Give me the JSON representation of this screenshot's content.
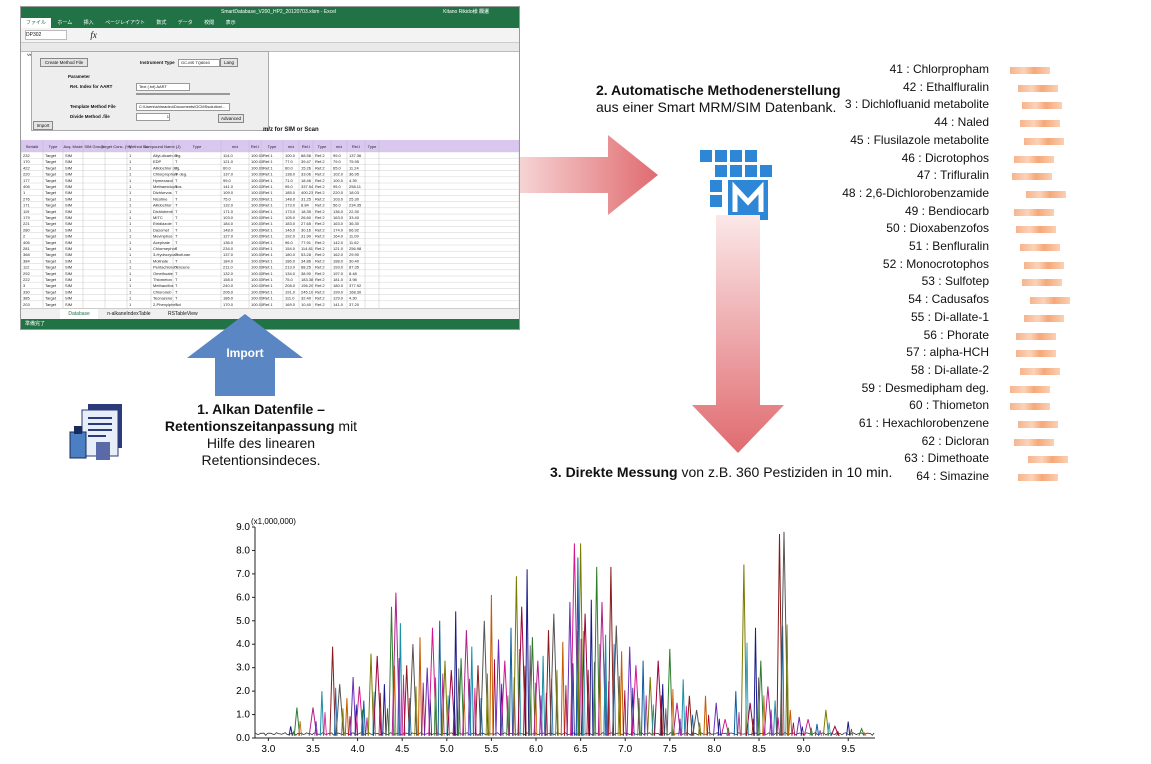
{
  "excel": {
    "title": "SmartDatabase_V200_HP2_20120703.xlsm - Excel",
    "user": "Kitano Rikido様 欄遷",
    "ribbon_tabs": [
      "ファイル",
      "ホーム",
      "挿入",
      "ページレイアウト",
      "数式",
      "データ",
      "校閲",
      "表示"
    ],
    "name_box": "DP302",
    "version_label": "Ver 0.99",
    "panel": {
      "create_button": "Create Method File",
      "instrument_label": "Instrument Type",
      "instrument_value": "GC-MS TQ8040",
      "lang_button": "Lang",
      "parameter_label": "Parameter",
      "ret_index_label": "Ret. Index for AART",
      "ret_index_value": "Text (.txt) AART",
      "template_label": "Template Method File",
      "template_value": "C:\\Users\\shimadzu\\Documents\\GCMSsolution\\...",
      "divide_label": "Divide Method .file",
      "divide_value": "1",
      "advanced_button": "Advanced",
      "import_button": "Import"
    },
    "header_label": "m/z for SIM or Scan",
    "columns": [
      "Serial#",
      "Type",
      "Acq. Mode",
      "SIM Group",
      "Target Conc. (%)",
      "Method No.",
      "Compound Name (J)",
      "Type",
      "m/z",
      "Rel.I",
      "Type",
      "m/z",
      "Rel.I",
      "Type",
      "m/z",
      "Rel.I",
      "Type"
    ],
    "rows": [
      [
        "232",
        "Target",
        "SIM",
        "",
        "",
        "1",
        "Allyl-dicarb deg.",
        "T",
        "114.0",
        "100.00",
        "Ref.1",
        "100.0",
        "88.56",
        "Ref.2",
        "99.0",
        "137.36"
      ],
      [
        "170",
        "Target",
        "SIM",
        "",
        "",
        "1",
        "EDP",
        "T",
        "121.0",
        "100.00",
        "Ref.1",
        "77.0",
        "39.47",
        "Ref.2",
        "79.0",
        "75.95"
      ],
      [
        "422",
        "Target",
        "SIM",
        "",
        "",
        "1",
        "Allidochlor deg.",
        "T",
        "60.0",
        "100.00",
        "Ref.1",
        "60.0",
        "15.26",
        "Ref.2",
        "65.0",
        "11.24"
      ],
      [
        "220",
        "Target",
        "SIM",
        "",
        "",
        "1",
        "Chlorpropham deg.",
        "T",
        "137.0",
        "100.00",
        "Ref.1",
        "138.0",
        "33.06",
        "Ref.2",
        "102.0",
        "36.95"
      ],
      [
        "177",
        "Target",
        "SIM",
        "",
        "",
        "1",
        "Hymexazol",
        "T",
        "99.0",
        "100.00",
        "Ref.1",
        "71.0",
        "18.46",
        "Ref.2",
        "100.0",
        "4.39"
      ],
      [
        "406",
        "Target",
        "SIM",
        "",
        "",
        "1",
        "Methamidophos",
        "T",
        "141.0",
        "100.00",
        "Ref.1",
        "95.0",
        "337.54",
        "Ref.2",
        "95.0",
        "258.11"
      ],
      [
        "1",
        "Target",
        "SIM",
        "",
        "",
        "1",
        "Dichlorvos",
        "T",
        "109.0",
        "100.00",
        "Ref.1",
        "185.0",
        "400.23",
        "Ref.2",
        "220.0",
        "18.03"
      ],
      [
        "276",
        "Target",
        "SIM",
        "",
        "",
        "1",
        "Nicotine",
        "T",
        "75.0",
        "100.00",
        "Ref.1",
        "148.0",
        "31.25",
        "Ref.2",
        "103.0",
        "25.30"
      ],
      [
        "171",
        "Target",
        "SIM",
        "",
        "",
        "1",
        "Allidochlor",
        "T",
        "132.0",
        "100.00",
        "Ref.1",
        "173.0",
        "8.84",
        "Ref.2",
        "56.0",
        "234.35"
      ],
      [
        "119",
        "Target",
        "SIM",
        "",
        "",
        "1",
        "Dichlobenil",
        "T",
        "171.0",
        "100.00",
        "Ref.1",
        "173.0",
        "18.35",
        "Ref.2",
        "136.0",
        "22.30"
      ],
      [
        "179",
        "Target",
        "SIM",
        "",
        "",
        "1",
        "MITC",
        "T",
        "103.0",
        "100.00",
        "Ref.1",
        "105.0",
        "26.60",
        "Ref.2",
        "163.0",
        "33.40"
      ],
      [
        "221",
        "Target",
        "SIM",
        "",
        "",
        "1",
        "Etridiazole",
        "T",
        "184.0",
        "100.00",
        "Ref.1",
        "183.0",
        "27.65",
        "Ref.2",
        "163.0",
        "36.30"
      ],
      [
        "280",
        "Target",
        "SIM",
        "",
        "",
        "1",
        "Dazomet",
        "T",
        "148.0",
        "100.00",
        "Ref.1",
        "146.0",
        "30.16",
        "Ref.2",
        "174.0",
        "66.92"
      ],
      [
        "2",
        "Target",
        "SIM",
        "",
        "",
        "1",
        "Mevinphos",
        "T",
        "127.0",
        "100.00",
        "Ref.1",
        "192.0",
        "31.90",
        "Ref.2",
        "164.0",
        "11.09"
      ],
      [
        "406",
        "Target",
        "SIM",
        "",
        "",
        "1",
        "Acephate",
        "T",
        "136.0",
        "100.00",
        "Ref.1",
        "96.0",
        "77.91",
        "Ref.2",
        "142.0",
        "11.62"
      ],
      [
        "281",
        "Target",
        "SIM",
        "",
        "",
        "1",
        "Chlormephos",
        "T",
        "234.0",
        "100.00",
        "Ref.1",
        "154.0",
        "114.81",
        "Ref.2",
        "121.0",
        "256.98"
      ],
      [
        "368",
        "Target",
        "SIM",
        "",
        "",
        "1",
        "3-Hydroxycarbofuran",
        "T",
        "137.0",
        "100.00",
        "Ref.1",
        "180.0",
        "53.28",
        "Ref.2",
        "162.0",
        "29.90"
      ],
      [
        "384",
        "Target",
        "SIM",
        "",
        "",
        "1",
        "Molinate",
        "T",
        "184.0",
        "100.00",
        "Ref.1",
        "186.0",
        "34.86",
        "Ref.2",
        "188.0",
        "30.40"
      ],
      [
        "112",
        "Target",
        "SIM",
        "",
        "",
        "1",
        "Pentachlorobenzene",
        "T",
        "211.0",
        "100.00",
        "Ref.1",
        "213.0",
        "68.25",
        "Ref.2",
        "193.0",
        "87.35"
      ],
      [
        "292",
        "Target",
        "SIM",
        "",
        "",
        "1",
        "Omethoate",
        "T",
        "132.0",
        "100.00",
        "Ref.1",
        "134.0",
        "38.90",
        "Ref.2",
        "197.0",
        "8.48"
      ],
      [
        "222",
        "Target",
        "SIM",
        "",
        "",
        "1",
        "Thiometon",
        "T",
        "158.0",
        "100.00",
        "Ref.1",
        "75.0",
        "183.38",
        "Ref.2",
        "181.0",
        "3.98"
      ],
      [
        "3",
        "Target",
        "SIM",
        "",
        "",
        "1",
        "Methacrifos",
        "T",
        "240.0",
        "100.00",
        "Ref.1",
        "208.0",
        "196.20",
        "Ref.2",
        "180.0",
        "377.92"
      ],
      [
        "330",
        "Target",
        "SIM",
        "",
        "",
        "1",
        "Chloroneb",
        "T",
        "206.0",
        "100.00",
        "Ref.1",
        "191.0",
        "245.10",
        "Ref.2",
        "199.0",
        "168.30"
      ],
      [
        "385",
        "Target",
        "SIM",
        "",
        "",
        "1",
        "Tecnazene",
        "T",
        "186.0",
        "100.00",
        "Ref.1",
        "111.0",
        "32.40",
        "Ref.2",
        "129.0",
        "4.30"
      ],
      [
        "203",
        "Target",
        "SIM",
        "",
        "",
        "1",
        "2-Phenylphenol",
        "T",
        "170.0",
        "100.00",
        "Ref.1",
        "169.0",
        "10.40",
        "Ref.2",
        "141.0",
        "37.20"
      ]
    ],
    "sheet_tabs": [
      "Database",
      "n-alkaneIndexTable",
      "RSTableView"
    ],
    "status": "準備完了"
  },
  "import_label": "Import",
  "step1": {
    "bold1": "1. Alkan Datenfile –",
    "bold2": "Retentionszeitanpassung",
    "rest1": " mit",
    "line3": "Hilfe des linearen",
    "line4": "Retentionsindeces."
  },
  "step2": {
    "bold": "2. Automatische Methodenerstellung",
    "line2": "aus einer Smart MRM/SIM Datenbank."
  },
  "step3": {
    "bold": "3. Direkte Messung",
    "rest": " von z.B. 360 Pestiziden in 10 min."
  },
  "compounds": [
    "41 : Chlorpropham",
    "42 : Ethalfluralin",
    "3 : Dichlofluanid metabolite",
    "44 : Naled",
    "45 : Flusilazole metabolite",
    "46 : Dicrotophos",
    "47 : Trifluralin",
    "48 : 2,6-Dichlorobenzamide",
    "49 : Bendiocarb",
    "50 : Dioxabenzofos",
    "51 : Benfluralin",
    "52 : Monocrotophos",
    "53 : Sulfotep",
    "54 : Cadusafos",
    "55 : Di-allate-1",
    "56 : Phorate",
    "57 : alpha-HCH",
    "58 : Di-allate-2",
    "59 : Desmedipham deg.",
    "60 : Thiometon",
    "61 : Hexachlorobenzene",
    "62 : Dicloran",
    "63 : Dimethoate",
    "64 : Simazine"
  ],
  "colors": {
    "arrow_blue": "#5a86c4",
    "arrow_red": "#e0797c",
    "logo_blue": "#2e86d6",
    "excel_green": "#217346"
  },
  "chart_data": {
    "type": "line",
    "title": "",
    "y_multiplier_label": "(x1,000,000)",
    "xlim": [
      2.85,
      9.8
    ],
    "ylim": [
      0,
      9.0
    ],
    "x_ticks": [
      "3.0",
      "3.5",
      "4.0",
      "4.5",
      "5.0",
      "5.5",
      "6.0",
      "6.5",
      "7.0",
      "7.5",
      "8.0",
      "8.5",
      "9.0",
      "9.5"
    ],
    "y_ticks": [
      "0.0",
      "1.0",
      "2.0",
      "3.0",
      "4.0",
      "5.0",
      "6.0",
      "7.0",
      "8.0",
      "9.0"
    ],
    "peaks": [
      [
        3.25,
        0.5
      ],
      [
        3.32,
        1.3
      ],
      [
        3.5,
        1.3
      ],
      [
        3.6,
        2.0
      ],
      [
        3.72,
        3.9
      ],
      [
        3.8,
        2.3
      ],
      [
        3.88,
        1.7
      ],
      [
        3.95,
        2.6
      ],
      [
        4.02,
        2.2
      ],
      [
        4.07,
        1.6
      ],
      [
        4.15,
        3.6
      ],
      [
        4.22,
        3.5
      ],
      [
        4.3,
        2.3
      ],
      [
        4.38,
        5.6
      ],
      [
        4.43,
        6.2
      ],
      [
        4.48,
        4.9
      ],
      [
        4.55,
        3.1
      ],
      [
        4.62,
        4.0
      ],
      [
        4.7,
        4.3
      ],
      [
        4.78,
        3.0
      ],
      [
        4.84,
        4.7
      ],
      [
        4.92,
        5.0
      ],
      [
        4.98,
        3.3
      ],
      [
        5.05,
        2.9
      ],
      [
        5.1,
        5.4
      ],
      [
        5.16,
        3.4
      ],
      [
        5.22,
        4.6
      ],
      [
        5.28,
        3.9
      ],
      [
        5.35,
        3.1
      ],
      [
        5.42,
        5.0
      ],
      [
        5.5,
        6.1
      ],
      [
        5.58,
        4.2
      ],
      [
        5.65,
        3.3
      ],
      [
        5.72,
        4.7
      ],
      [
        5.78,
        6.9
      ],
      [
        5.84,
        5.6
      ],
      [
        5.9,
        7.2
      ],
      [
        5.96,
        4.3
      ],
      [
        6.02,
        3.3
      ],
      [
        6.08,
        3.5
      ],
      [
        6.14,
        4.6
      ],
      [
        6.2,
        5.3
      ],
      [
        6.3,
        4.1
      ],
      [
        6.38,
        5.8
      ],
      [
        6.43,
        8.3
      ],
      [
        6.47,
        7.7
      ],
      [
        6.5,
        8.3
      ],
      [
        6.55,
        5.3
      ],
      [
        6.62,
        5.9
      ],
      [
        6.68,
        7.3
      ],
      [
        6.74,
        5.8
      ],
      [
        6.78,
        4.4
      ],
      [
        6.84,
        7.3
      ],
      [
        6.9,
        4.8
      ],
      [
        6.96,
        3.7
      ],
      [
        7.05,
        3.9
      ],
      [
        7.12,
        3.1
      ],
      [
        7.2,
        3.3
      ],
      [
        7.28,
        2.6
      ],
      [
        7.37,
        3.3
      ],
      [
        7.42,
        2.3
      ],
      [
        7.5,
        3.8
      ],
      [
        7.58,
        1.5
      ],
      [
        7.65,
        2.5
      ],
      [
        7.72,
        1.8
      ],
      [
        7.8,
        1.2
      ],
      [
        7.9,
        1.8
      ],
      [
        8.02,
        1.5
      ],
      [
        8.12,
        0.8
      ],
      [
        8.24,
        2.0
      ],
      [
        8.33,
        7.4
      ],
      [
        8.4,
        1.5
      ],
      [
        8.46,
        4.7
      ],
      [
        8.52,
        3.3
      ],
      [
        8.6,
        2.2
      ],
      [
        8.68,
        1.6
      ],
      [
        8.73,
        8.7
      ],
      [
        8.78,
        8.8
      ],
      [
        8.85,
        1.2
      ],
      [
        8.95,
        0.9
      ],
      [
        9.05,
        0.8
      ],
      [
        9.15,
        0.6
      ],
      [
        9.25,
        1.2
      ],
      [
        9.35,
        0.5
      ],
      [
        9.5,
        0.7
      ],
      [
        9.65,
        0.4
      ]
    ]
  }
}
